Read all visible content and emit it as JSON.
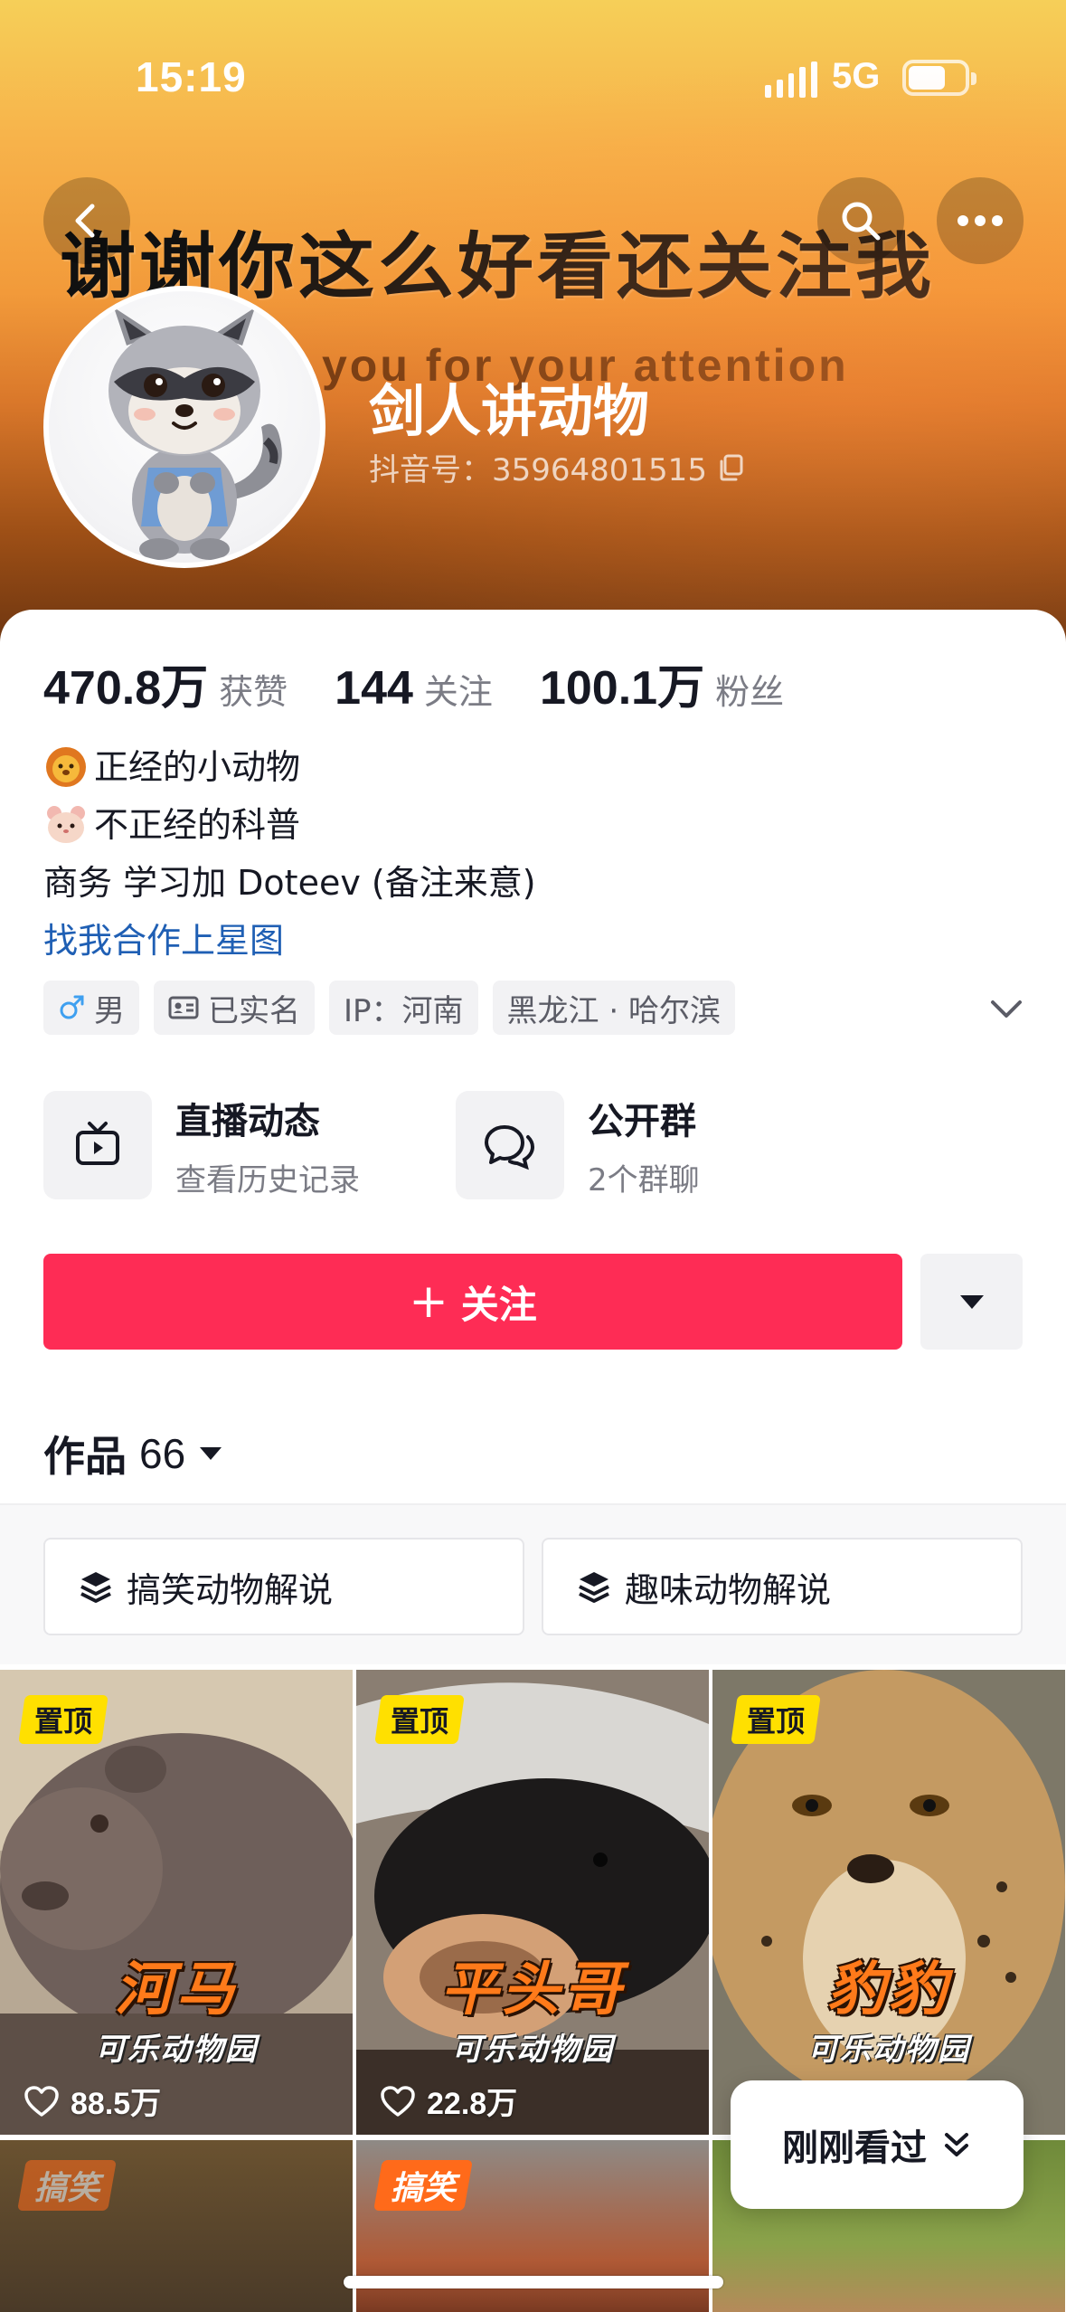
{
  "status_bar": {
    "time": "15:19",
    "network": "5G"
  },
  "banner": {
    "headline": "谢谢你这么好看还关注我",
    "subline": "you  for  your  attention"
  },
  "profile": {
    "name": "剑人讲动物",
    "douyin_id": "抖音号：35964801515"
  },
  "stats": [
    {
      "value": "470.8万",
      "label": "获赞"
    },
    {
      "value": "144",
      "label": "关注"
    },
    {
      "value": "100.1万",
      "label": "粉丝"
    }
  ],
  "bio": {
    "line1": "正经的小动物",
    "line2": "不正经的科普",
    "line3": "商务 学习加 Doteev (备注来意)",
    "link": "找我合作上星图"
  },
  "tags": {
    "gender": "男",
    "verified": "已实名",
    "ip": "IP：河南",
    "location": "黑龙江 · 哈尔滨"
  },
  "quick_links": [
    {
      "title": "直播动态",
      "subtitle": "查看历史记录"
    },
    {
      "title": "公开群",
      "subtitle": "2个群聊"
    }
  ],
  "follow_button": {
    "plus": "+",
    "label": "关注"
  },
  "works": {
    "label": "作品",
    "count": "66"
  },
  "collections": [
    "搞笑动物解说",
    "趣味动物解说"
  ],
  "videos": [
    {
      "pin": "置顶",
      "title": "河马",
      "subtitle": "可乐动物园",
      "likes": "88.5万"
    },
    {
      "pin": "置顶",
      "title": "平头哥",
      "subtitle": "可乐动物园",
      "likes": "22.8万"
    },
    {
      "pin": "置顶",
      "title": "豹豹",
      "subtitle": "可乐动物园",
      "likes": ""
    }
  ],
  "second_row_tags": [
    "搞笑",
    "搞笑"
  ],
  "recent_button": "刚刚看过",
  "colors": {
    "accent": "#fe2c55",
    "link": "#1f5fb4",
    "pin": "#ffe000"
  }
}
